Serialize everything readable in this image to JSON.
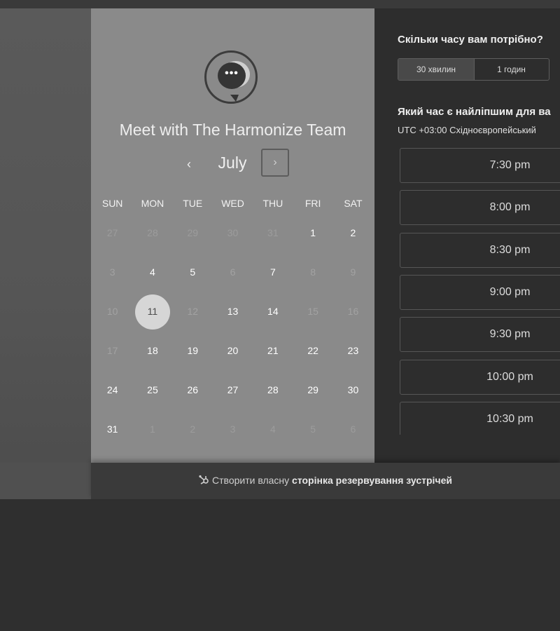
{
  "calendar": {
    "title": "Meet with The Harmonize Team",
    "logo_text": "•••",
    "prev_icon": "‹",
    "next_icon": "›",
    "month": "July",
    "weekdays": [
      "SUN",
      "MON",
      "TUE",
      "WED",
      "THU",
      "FRI",
      "SAT"
    ],
    "weeks": [
      [
        {
          "d": "27",
          "s": "other"
        },
        {
          "d": "28",
          "s": "other"
        },
        {
          "d": "29",
          "s": "other"
        },
        {
          "d": "30",
          "s": "other"
        },
        {
          "d": "31",
          "s": "other"
        },
        {
          "d": "1",
          "s": "cur"
        },
        {
          "d": "2",
          "s": "cur"
        }
      ],
      [
        {
          "d": "3",
          "s": "dim"
        },
        {
          "d": "4",
          "s": "cur"
        },
        {
          "d": "5",
          "s": "cur"
        },
        {
          "d": "6",
          "s": "dim"
        },
        {
          "d": "7",
          "s": "cur"
        },
        {
          "d": "8",
          "s": "dim"
        },
        {
          "d": "9",
          "s": "dim"
        }
      ],
      [
        {
          "d": "10",
          "s": "dim"
        },
        {
          "d": "11",
          "s": "sel"
        },
        {
          "d": "12",
          "s": "dim"
        },
        {
          "d": "13",
          "s": "cur"
        },
        {
          "d": "14",
          "s": "cur"
        },
        {
          "d": "15",
          "s": "dim"
        },
        {
          "d": "16",
          "s": "dim"
        }
      ],
      [
        {
          "d": "17",
          "s": "dim"
        },
        {
          "d": "18",
          "s": "cur"
        },
        {
          "d": "19",
          "s": "cur"
        },
        {
          "d": "20",
          "s": "cur"
        },
        {
          "d": "21",
          "s": "cur"
        },
        {
          "d": "22",
          "s": "cur"
        },
        {
          "d": "23",
          "s": "cur"
        }
      ],
      [
        {
          "d": "24",
          "s": "cur"
        },
        {
          "d": "25",
          "s": "cur"
        },
        {
          "d": "26",
          "s": "cur"
        },
        {
          "d": "27",
          "s": "cur"
        },
        {
          "d": "28",
          "s": "cur"
        },
        {
          "d": "29",
          "s": "cur"
        },
        {
          "d": "30",
          "s": "cur"
        }
      ],
      [
        {
          "d": "31",
          "s": "cur"
        },
        {
          "d": "1",
          "s": "other"
        },
        {
          "d": "2",
          "s": "other"
        },
        {
          "d": "3",
          "s": "other"
        },
        {
          "d": "4",
          "s": "other"
        },
        {
          "d": "5",
          "s": "other"
        },
        {
          "d": "6",
          "s": "other"
        }
      ]
    ]
  },
  "scheduler": {
    "duration_question": "Скільки часу вам потрібно?",
    "durations": [
      "30 хвилин",
      "1 годин"
    ],
    "time_question": "Який час є найліпшим для ва",
    "timezone": "UTC +03:00 Східноєвропейський",
    "slots": [
      "7:30 pm",
      "8:00 pm",
      "8:30 pm",
      "9:00 pm",
      "9:30 pm",
      "10:00 pm",
      "10:30 pm"
    ]
  },
  "footer": {
    "icon": "sprocket-icon",
    "prefix": "Створити власну ",
    "bold": "сторінка резервування зустрічей"
  }
}
